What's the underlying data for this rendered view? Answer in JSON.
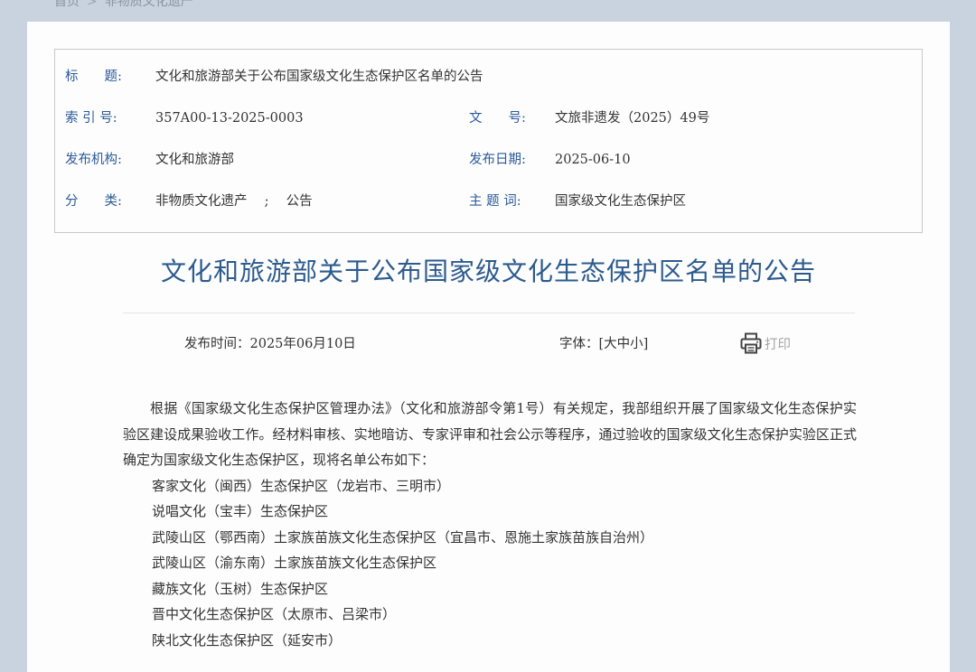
{
  "breadcrumb": {
    "home": "首页",
    "separator": ">",
    "current": "非物质文化遗产"
  },
  "meta": {
    "title_label": "标　　题:",
    "title_value": "文化和旅游部关于公布国家级文化生态保护区名单的公告",
    "index_label": "索 引 号:",
    "index_value": "357A00-13-2025-0003",
    "docno_label": "文　　号:",
    "docno_value": "文旅非遗发（2025）49号",
    "publisher_label": "发布机构:",
    "publisher_value": "文化和旅游部",
    "date_label": "发布日期:",
    "date_value": "2025-06-10",
    "category_label": "分　　类:",
    "category_value": "非物质文化遗产　 ;　 公告",
    "keyword_label": "主 题 词:",
    "keyword_value": "国家级文化生态保护区"
  },
  "article": {
    "title": "文化和旅游部关于公布国家级文化生态保护区名单的公告",
    "publish_time": "发布时间：2025年06月10日",
    "font_size_label": "字体：[大中小]",
    "print_label": "打印",
    "intro": "根据《国家级文化生态保护区管理办法》（文化和旅游部令第1号）有关规定，我部组织开展了国家级文化生态保护实验区建设成果验收工作。经材料审核、实地暗访、专家评审和社会公示等程序，通过验收的国家级文化生态保护实验区正式确定为国家级文化生态保护区，现将名单公布如下：",
    "list": [
      "客家文化（闽西）生态保护区（龙岩市、三明市）",
      "说唱文化（宝丰）生态保护区",
      "武陵山区（鄂西南）土家族苗族文化生态保护区（宜昌市、恩施土家族苗族自治州）",
      "武陵山区（渝东南）土家族苗族文化生态保护区",
      "藏族文化（玉树）生态保护区",
      "晋中文化生态保护区（太原市、吕梁市）",
      "陕北文化生态保护区（延安市）"
    ]
  },
  "colors": {
    "page_bg": "#c8d3df",
    "label_blue": "#2b5a9a",
    "title_blue": "#2d5b8e",
    "text": "#333333"
  }
}
